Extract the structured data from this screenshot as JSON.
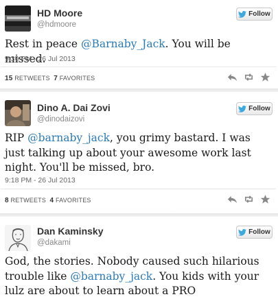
{
  "colors": {
    "mention": "#2a7ab8",
    "twitter_bird": "#3ea9de",
    "meta_gray": "#666666"
  },
  "tweets": [
    {
      "name": "HD Moore",
      "handle": "@hdmoore",
      "follow_label": "Follow",
      "text_parts": [
        "Rest in peace ",
        "@Barnaby_Jack",
        ". You will be missed."
      ],
      "timestamp": "9:30 PM - 26 Jul 2013",
      "retweets_count": "15",
      "retweets_label": "RETWEETS",
      "favorites_count": "7",
      "favorites_label": "FAVORITES",
      "avatar": "dark-photo"
    },
    {
      "name": "Dino A. Dai Zovi",
      "handle": "@dinodaizovi",
      "follow_label": "Follow",
      "text_parts": [
        "RIP ",
        "@barnaby_jack",
        ", you grimy bastard. I was just talking up about your awesome work last night. You'll be missed, bro."
      ],
      "timestamp": "9:18 PM - 26 Jul 2013",
      "retweets_count": "8",
      "retweets_label": "RETWEETS",
      "favorites_count": "4",
      "favorites_label": "FAVORITES",
      "avatar": "photo"
    },
    {
      "name": "Dan Kaminsky",
      "handle": "@dakami",
      "follow_label": "Follow",
      "text_parts": [
        "God, the stories.  Nobody caused such hilarious trouble like ",
        "@barnaby_jack",
        ". You kids with your lulz are about to learn about a PRO"
      ],
      "avatar": "sketch"
    }
  ]
}
